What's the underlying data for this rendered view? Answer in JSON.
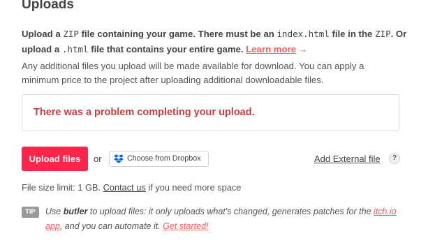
{
  "section": {
    "title": "Uploads"
  },
  "instructions": {
    "part1": "Upload a ",
    "code_zip": "ZIP",
    "part2": " file containing your game. There must be an ",
    "code_index": "index.html",
    "part3": " file in the ",
    "code_zip2": "ZIP",
    "part4": ". Or upload a ",
    "code_html": ".html",
    "part5": " file that contains your entire game. ",
    "learn_more": "Learn more",
    "arrow": "→"
  },
  "additional_info": "Any additional files you upload will be made available for download. You can apply a minimum price to the project after uploading additional downloadable files.",
  "error": {
    "message": "There was a problem completing your upload."
  },
  "actions": {
    "upload_label": "Upload files",
    "or_label": "or",
    "dropbox_label": "Choose from Dropbox",
    "external_label": "Add External file",
    "help_label": "?"
  },
  "file_limit": {
    "prefix": "File size limit: 1 GB. ",
    "contact_link": "Contact us",
    "suffix": " if you need more space"
  },
  "tip": {
    "badge": "TIP",
    "use": "Use ",
    "butler": "butler",
    "text1": " to upload files: it only uploads what's changed, generates patches for the ",
    "app_link": "itch.io app",
    "text2": ", and you can automate it. ",
    "started_link": "Get started!"
  },
  "colors": {
    "accent": "#fa5c5c",
    "button_bg": "#ff2449",
    "error_text": "#c54040",
    "dropbox_blue": "#0061fe"
  },
  "icons": {
    "dropbox": "dropbox-icon",
    "help": "question-icon"
  }
}
